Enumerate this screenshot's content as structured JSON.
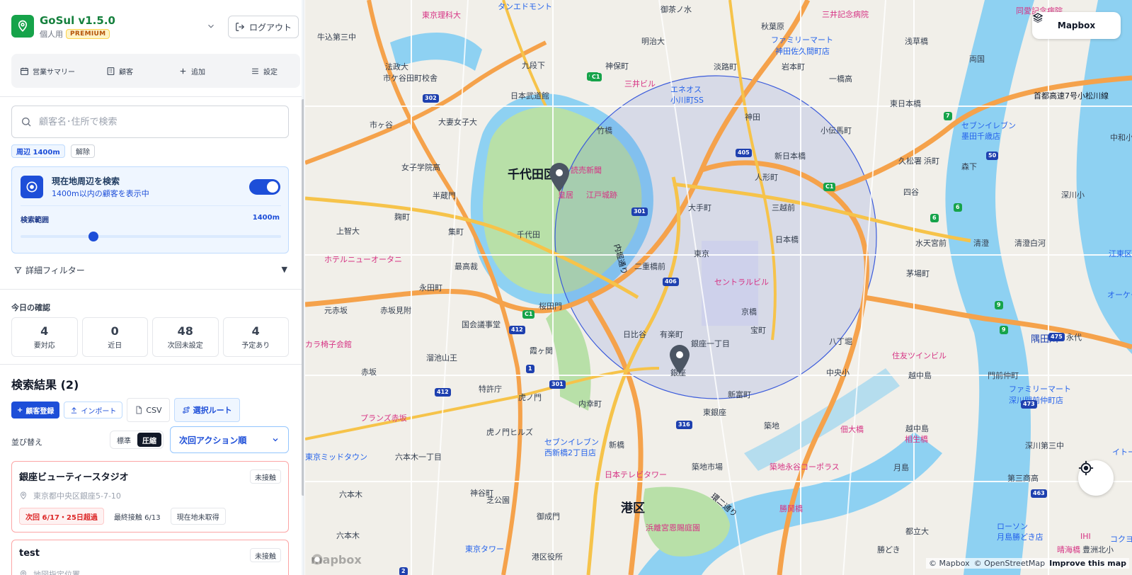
{
  "app": {
    "title": "GoSul v1.5.0",
    "plan": "個人用",
    "plan_badge": "PREMIUM",
    "logout_label": "ログアウト"
  },
  "nav": {
    "items": [
      {
        "label": "営業サマリー",
        "icon": "calendar-icon"
      },
      {
        "label": "顧客",
        "icon": "building-icon"
      },
      {
        "label": "追加",
        "icon": "plus-icon"
      },
      {
        "label": "設定",
        "icon": "menu-icon"
      }
    ]
  },
  "search": {
    "placeholder": "顧客名･住所で検索",
    "value": ""
  },
  "chips": {
    "range": "周辺 1400m",
    "clear": "解除"
  },
  "nearby": {
    "title": "現在地周辺を検索",
    "subtitle": "1400m以内の顧客を表示中",
    "enabled": true,
    "range_label": "検索範囲",
    "range_value": "1400m",
    "slider_fraction": 0.28
  },
  "filters": {
    "label": "詳細フィルター",
    "caret": "▼"
  },
  "today": {
    "label": "今日の確認",
    "stats": [
      {
        "value": "4",
        "label": "要対応"
      },
      {
        "value": "0",
        "label": "近日"
      },
      {
        "value": "48",
        "label": "次回未設定"
      },
      {
        "value": "4",
        "label": "予定あり"
      }
    ]
  },
  "results": {
    "title": "検索結果 (2)",
    "actions": {
      "register": "顧客登録",
      "import": "インポート",
      "csv": "CSV",
      "route": "選択ルート"
    },
    "sort_label": "並び替え",
    "density": [
      "標準",
      "圧縮"
    ],
    "density_active": "圧縮",
    "sort_value": "次回アクション順",
    "items": [
      {
        "name": "銀座ビューティースタジオ",
        "status": "未接触",
        "address": "東京都中央区銀座5-7-10",
        "tags": [
          "次回 6/17・25日超過",
          "最終接触 6/13",
          "現在地未取得"
        ]
      },
      {
        "name": "test",
        "status": "未接触",
        "address": "地図指定位置",
        "tags": []
      }
    ]
  },
  "map": {
    "style_label": "Mapbox",
    "logo": "mapbox",
    "attribution": [
      "© Mapbox",
      "© OpenStreetMap"
    ],
    "improve": "Improve this map",
    "colors": {
      "water": "#8ed1f2",
      "park": "#b8e0a8",
      "road_major": "#f6c34a",
      "road_highway": "#f5a24b",
      "radius": "#3b5bdb",
      "pin": "#4b5563"
    },
    "labels": [
      {
        "text": "東京理科大",
        "cls": "pink"
      },
      {
        "text": "タンエドモント",
        "cls": "blue"
      },
      {
        "text": "御茶ノ水",
        "cls": ""
      },
      {
        "text": "三井記念病院",
        "cls": "pink"
      },
      {
        "text": "同愛記念病院",
        "cls": "pink"
      },
      {
        "text": "牛込第三中",
        "cls": ""
      },
      {
        "text": "明治大",
        "cls": ""
      },
      {
        "text": "秋葉原",
        "cls": ""
      },
      {
        "text": "ファミリーマート",
        "cls": "blue"
      },
      {
        "text": "神田佐久間町店",
        "cls": "blue"
      },
      {
        "text": "浅草橋",
        "cls": ""
      },
      {
        "text": "両国",
        "cls": ""
      },
      {
        "text": "法政大",
        "cls": ""
      },
      {
        "text": "市ケ谷田町校舎",
        "cls": ""
      },
      {
        "text": "九段下",
        "cls": ""
      },
      {
        "text": "神保町",
        "cls": ""
      },
      {
        "text": "淡路町",
        "cls": ""
      },
      {
        "text": "岩本町",
        "cls": ""
      },
      {
        "text": "一橋高",
        "cls": ""
      },
      {
        "text": "首都高速7号小松川線",
        "cls": "road"
      },
      {
        "text": "三井ビル",
        "cls": "pink"
      },
      {
        "text": "エネオス",
        "cls": "blue"
      },
      {
        "text": "小川町SS",
        "cls": "blue"
      },
      {
        "text": "日本武道館",
        "cls": ""
      },
      {
        "text": "市ヶ谷",
        "cls": ""
      },
      {
        "text": "大妻女子大",
        "cls": ""
      },
      {
        "text": "神田",
        "cls": ""
      },
      {
        "text": "東日本橋",
        "cls": ""
      },
      {
        "text": "セブンイレブン",
        "cls": "blue"
      },
      {
        "text": "墨田千歳店",
        "cls": "blue"
      },
      {
        "text": "小伝馬町",
        "cls": ""
      },
      {
        "text": "中和小",
        "cls": ""
      },
      {
        "text": "竹橋",
        "cls": ""
      },
      {
        "text": "新日本橋",
        "cls": ""
      },
      {
        "text": "久松署",
        "cls": ""
      },
      {
        "text": "浜町",
        "cls": ""
      },
      {
        "text": "森下",
        "cls": ""
      },
      {
        "text": "女子学院高",
        "cls": ""
      },
      {
        "text": "千代田区",
        "cls": "big"
      },
      {
        "text": "読売新聞",
        "cls": "pink"
      },
      {
        "text": "人形町",
        "cls": ""
      },
      {
        "text": "四谷",
        "cls": ""
      },
      {
        "text": "半蔵門",
        "cls": ""
      },
      {
        "text": "皇居",
        "cls": "pink"
      },
      {
        "text": "江戸城跡",
        "cls": "pink"
      },
      {
        "text": "深川小",
        "cls": ""
      },
      {
        "text": "麹町",
        "cls": ""
      },
      {
        "text": "大手町",
        "cls": ""
      },
      {
        "text": "三越前",
        "cls": ""
      },
      {
        "text": "上智大",
        "cls": ""
      },
      {
        "text": "集町",
        "cls": ""
      },
      {
        "text": "千代田",
        "cls": ""
      },
      {
        "text": "日本橋",
        "cls": ""
      },
      {
        "text": "水天宮前",
        "cls": ""
      },
      {
        "text": "清澄",
        "cls": ""
      },
      {
        "text": "清澄白河",
        "cls": ""
      },
      {
        "text": "江東区",
        "cls": "blue"
      },
      {
        "text": "ホテルニューオータニ",
        "cls": "pink"
      },
      {
        "text": "内堀通り",
        "cls": "road"
      },
      {
        "text": "東京",
        "cls": ""
      },
      {
        "text": "最高裁",
        "cls": ""
      },
      {
        "text": "二重橋前",
        "cls": ""
      },
      {
        "text": "茅場町",
        "cls": ""
      },
      {
        "text": "セントラルビル",
        "cls": "pink"
      },
      {
        "text": "オーケー",
        "cls": "blue"
      },
      {
        "text": "永田町",
        "cls": ""
      },
      {
        "text": "元赤坂",
        "cls": ""
      },
      {
        "text": "赤坂見附",
        "cls": ""
      },
      {
        "text": "桜田門",
        "cls": ""
      },
      {
        "text": "京橋",
        "cls": ""
      },
      {
        "text": "国会議事堂",
        "cls": ""
      },
      {
        "text": "宝町",
        "cls": ""
      },
      {
        "text": "八丁堀",
        "cls": ""
      },
      {
        "text": "隅田川",
        "cls": "water"
      },
      {
        "text": "永代",
        "cls": ""
      },
      {
        "text": "カラ椅子会館",
        "cls": "pink"
      },
      {
        "text": "日比谷",
        "cls": ""
      },
      {
        "text": "有楽町",
        "cls": ""
      },
      {
        "text": "銀座一丁目",
        "cls": ""
      },
      {
        "text": "住友ツインビル",
        "cls": "pink"
      },
      {
        "text": "溜池山王",
        "cls": ""
      },
      {
        "text": "霞ヶ関",
        "cls": ""
      },
      {
        "text": "銀座",
        "cls": ""
      },
      {
        "text": "中央小",
        "cls": ""
      },
      {
        "text": "越中島",
        "cls": ""
      },
      {
        "text": "門前仲町",
        "cls": ""
      },
      {
        "text": "赤坂",
        "cls": ""
      },
      {
        "text": "特許庁",
        "cls": ""
      },
      {
        "text": "虎ノ門",
        "cls": ""
      },
      {
        "text": "内幸町",
        "cls": ""
      },
      {
        "text": "新富町",
        "cls": ""
      },
      {
        "text": "ファミリーマート",
        "cls": "blue"
      },
      {
        "text": "深川門前仲町店",
        "cls": "blue"
      },
      {
        "text": "東銀座",
        "cls": ""
      },
      {
        "text": "プランズ赤坂",
        "cls": "pink"
      },
      {
        "text": "築地",
        "cls": ""
      },
      {
        "text": "越中島",
        "cls": ""
      },
      {
        "text": "佃大橋",
        "cls": "pink"
      },
      {
        "text": "相生橋",
        "cls": "pink"
      },
      {
        "text": "虎ノ門ヒルズ",
        "cls": ""
      },
      {
        "text": "セブンイレブン",
        "cls": "blue"
      },
      {
        "text": "西新橋2丁目店",
        "cls": "blue"
      },
      {
        "text": "新橋",
        "cls": ""
      },
      {
        "text": "深川第三中",
        "cls": ""
      },
      {
        "text": "東京ミッドタウン",
        "cls": "blue"
      },
      {
        "text": "六本木一丁目",
        "cls": ""
      },
      {
        "text": "築地市場",
        "cls": ""
      },
      {
        "text": "築地永谷コーポラス",
        "cls": "pink"
      },
      {
        "text": "月島",
        "cls": ""
      },
      {
        "text": "日本テレビタワー",
        "cls": "pink"
      },
      {
        "text": "第三商高",
        "cls": ""
      },
      {
        "text": "六本木",
        "cls": ""
      },
      {
        "text": "神谷町",
        "cls": ""
      },
      {
        "text": "芝公園",
        "cls": ""
      },
      {
        "text": "環二通り",
        "cls": "road"
      },
      {
        "text": "勝鬨橋",
        "cls": "pink"
      },
      {
        "text": "御成門",
        "cls": ""
      },
      {
        "text": "港区",
        "cls": "big"
      },
      {
        "text": "ローソン",
        "cls": "blue"
      },
      {
        "text": "月島勝どき店",
        "cls": "blue"
      },
      {
        "text": "浜離宮恩賜庭園",
        "cls": "pink"
      },
      {
        "text": "都立大",
        "cls": ""
      },
      {
        "text": "IHI",
        "cls": "pink"
      },
      {
        "text": "六本木",
        "cls": ""
      },
      {
        "text": "東京タワー",
        "cls": "blue"
      },
      {
        "text": "港区役所",
        "cls": ""
      },
      {
        "text": "勝どき",
        "cls": ""
      },
      {
        "text": "晴海橋",
        "cls": "pink"
      },
      {
        "text": "豊洲北小",
        "cls": ""
      },
      {
        "text": "コクヨ",
        "cls": "blue"
      },
      {
        "text": "イトーヨ",
        "cls": "blue"
      }
    ],
    "route_shields": [
      "C1",
      "C1",
      "302",
      "405",
      "301",
      "406",
      "C1",
      "412",
      "412",
      "1",
      "301",
      "316",
      "473",
      "463",
      "475",
      "7",
      "50",
      "6",
      "6",
      "9",
      "9",
      "2",
      "C1"
    ]
  }
}
